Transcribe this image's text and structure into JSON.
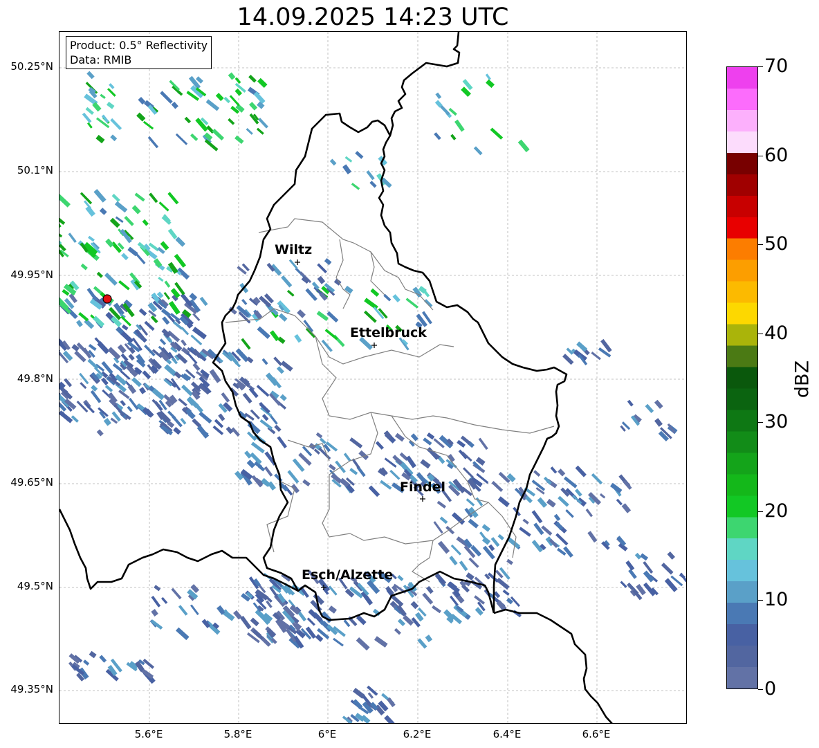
{
  "title": "14.09.2025 14:23 UTC",
  "info_box": {
    "product": "Product: 0.5° Reflectivity",
    "data": "Data: RMIB"
  },
  "lat_ticks": [
    "50.25°N",
    "50.1°N",
    "49.95°N",
    "49.8°N",
    "49.65°N",
    "49.5°N",
    "49.35°N"
  ],
  "lon_ticks": [
    "5.6°E",
    "5.8°E",
    "6°E",
    "6.2°E",
    "6.4°E",
    "6.6°E"
  ],
  "cities": [
    {
      "name": "Wiltz"
    },
    {
      "name": "Ettelbruck"
    },
    {
      "name": "Findel"
    },
    {
      "name": "Esch/Alzette"
    }
  ],
  "colorbar": {
    "unit": "dBZ",
    "ticks": [
      "0",
      "10",
      "20",
      "30",
      "40",
      "50",
      "60",
      "70"
    ],
    "colors": [
      "#6272a6",
      "#5266a0",
      "#4861a3",
      "#4a79b4",
      "#5aa0c8",
      "#66c2dc",
      "#5fd6c4",
      "#3dd670",
      "#12c824",
      "#14b81a",
      "#14a41a",
      "#128c18",
      "#0e7814",
      "#0b6410",
      "#0a580c",
      "#4b7a14",
      "#aab40a",
      "#fdd800",
      "#fcba00",
      "#fc9e00",
      "#fc7d00",
      "#e80000",
      "#c80000",
      "#a00000",
      "#780000",
      "#fcdcfc",
      "#fcb0fc",
      "#fc6cfc",
      "#ee40ee"
    ]
  },
  "radar": {
    "marker_color": "#e01010"
  }
}
